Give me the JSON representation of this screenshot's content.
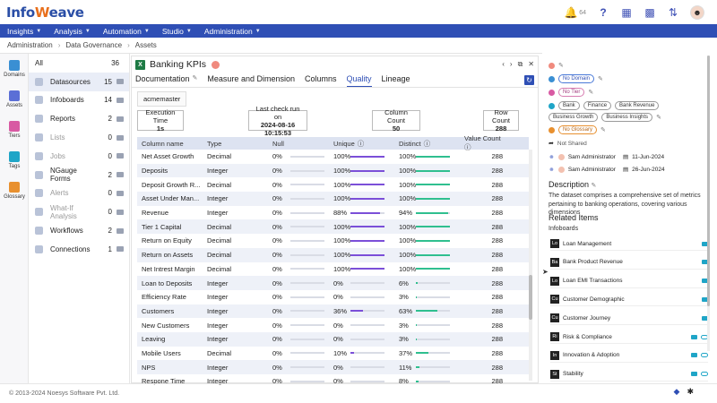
{
  "brand": {
    "prefix": "Info",
    "w": "W",
    "suffix": "eave"
  },
  "topbar": {
    "notif_count": "64"
  },
  "nav": [
    {
      "label": "Insights"
    },
    {
      "label": "Analysis"
    },
    {
      "label": "Automation"
    },
    {
      "label": "Studio"
    },
    {
      "label": "Administration"
    }
  ],
  "breadcrumb": [
    "Administration",
    "Data Governance",
    "Assets"
  ],
  "rail": [
    {
      "label": "Domains",
      "color": "#3a8fd3"
    },
    {
      "label": "Assets",
      "color": "#5b6fd6"
    },
    {
      "label": "Tiers",
      "color": "#d85aa3"
    },
    {
      "label": "Tags",
      "color": "#1fa5c7"
    },
    {
      "label": "Glossary",
      "color": "#e8902f"
    }
  ],
  "categories": [
    {
      "label": "All",
      "count": "36"
    },
    {
      "label": "Datasources",
      "count": "15"
    },
    {
      "label": "Infoboards",
      "count": "14"
    },
    {
      "label": "Reports",
      "count": "2"
    },
    {
      "label": "Lists",
      "count": "0"
    },
    {
      "label": "Jobs",
      "count": "0"
    },
    {
      "label": "NGauge Forms",
      "count": "2"
    },
    {
      "label": "Alerts",
      "count": "0"
    },
    {
      "label": "What-If Analysis",
      "count": "0"
    },
    {
      "label": "Workflows",
      "count": "2"
    },
    {
      "label": "Connections",
      "count": "1"
    }
  ],
  "asset": {
    "title": "Banking KPIs",
    "connection": "acmemaster"
  },
  "tabs": [
    "Documentation",
    "Measure and Dimension",
    "Columns",
    "Quality",
    "Lineage"
  ],
  "stats": [
    {
      "label": "Execution Time",
      "value": "1s"
    },
    {
      "label": "Last check run on",
      "value": "2024-08-16 10:15:53"
    },
    {
      "label": "Column Count",
      "value": "50"
    },
    {
      "label": "Row Count",
      "value": "288"
    }
  ],
  "table": {
    "headers": [
      "Column name",
      "Type",
      "Null",
      "Unique",
      "Distinct",
      "Value Count"
    ],
    "rows": [
      {
        "name": "Net Asset Growth",
        "type": "Decimal",
        "null": "0%",
        "unique": "100%",
        "distinct": "100%",
        "count": "288",
        "u": 1.0,
        "d": 1.0
      },
      {
        "name": "Deposits",
        "type": "Integer",
        "null": "0%",
        "unique": "100%",
        "distinct": "100%",
        "count": "288",
        "u": 1.0,
        "d": 1.0
      },
      {
        "name": "Deposit Growth R...",
        "type": "Decimal",
        "null": "0%",
        "unique": "100%",
        "distinct": "100%",
        "count": "288",
        "u": 1.0,
        "d": 1.0
      },
      {
        "name": "Asset Under Man...",
        "type": "Integer",
        "null": "0%",
        "unique": "100%",
        "distinct": "100%",
        "count": "288",
        "u": 1.0,
        "d": 1.0
      },
      {
        "name": "Revenue",
        "type": "Integer",
        "null": "0%",
        "unique": "88%",
        "distinct": "94%",
        "count": "288",
        "u": 0.88,
        "d": 0.94
      },
      {
        "name": "Tier 1 Capital",
        "type": "Decimal",
        "null": "0%",
        "unique": "100%",
        "distinct": "100%",
        "count": "288",
        "u": 1.0,
        "d": 1.0
      },
      {
        "name": "Return on Equity",
        "type": "Decimal",
        "null": "0%",
        "unique": "100%",
        "distinct": "100%",
        "count": "288",
        "u": 1.0,
        "d": 1.0
      },
      {
        "name": "Return on Assets",
        "type": "Decimal",
        "null": "0%",
        "unique": "100%",
        "distinct": "100%",
        "count": "288",
        "u": 1.0,
        "d": 1.0
      },
      {
        "name": "Net Intrest Margin",
        "type": "Decimal",
        "null": "0%",
        "unique": "100%",
        "distinct": "100%",
        "count": "288",
        "u": 1.0,
        "d": 1.0
      },
      {
        "name": "Loan to Deposits",
        "type": "Integer",
        "null": "0%",
        "unique": "0%",
        "distinct": "6%",
        "count": "288",
        "u": 0.0,
        "d": 0.06
      },
      {
        "name": "Efficiency Rate",
        "type": "Integer",
        "null": "0%",
        "unique": "0%",
        "distinct": "3%",
        "count": "288",
        "u": 0.0,
        "d": 0.03
      },
      {
        "name": "Customers",
        "type": "Integer",
        "null": "0%",
        "unique": "36%",
        "distinct": "63%",
        "count": "288",
        "u": 0.36,
        "d": 0.63
      },
      {
        "name": "New Customers",
        "type": "Integer",
        "null": "0%",
        "unique": "0%",
        "distinct": "3%",
        "count": "288",
        "u": 0.0,
        "d": 0.03
      },
      {
        "name": "Leaving",
        "type": "Integer",
        "null": "0%",
        "unique": "0%",
        "distinct": "3%",
        "count": "288",
        "u": 0.0,
        "d": 0.03
      },
      {
        "name": "Mobile Users",
        "type": "Decimal",
        "null": "0%",
        "unique": "10%",
        "distinct": "37%",
        "count": "288",
        "u": 0.1,
        "d": 0.37
      },
      {
        "name": "NPS",
        "type": "Integer",
        "null": "0%",
        "unique": "0%",
        "distinct": "11%",
        "count": "288",
        "u": 0.0,
        "d": 0.11
      },
      {
        "name": "Respone Time",
        "type": "Integer",
        "null": "0%",
        "unique": "0%",
        "distinct": "8%",
        "count": "288",
        "u": 0.0,
        "d": 0.08
      }
    ]
  },
  "right": {
    "domain_chip": "No Domain",
    "tier_chip": "No Tier",
    "tags": [
      "Bank",
      "Finance",
      "Bank Revenue",
      "Business Growth",
      "Business Insights"
    ],
    "glossary_chip": "No Glossary",
    "shared": "Not Shared",
    "created_by": "Sam Administrator",
    "created_on": "11-Jun-2024",
    "modified_by": "Sam Administrator",
    "modified_on": "26-Jun-2024",
    "description_heading": "Description",
    "description": "The dataset comprises a comprehensive set of metrics pertaining to banking operations, covering various dimensions",
    "related_heading": "Related Items",
    "infoboards_label": "Infoboards",
    "related": [
      {
        "badge": "Lo",
        "label": "Loan Management",
        "link": false
      },
      {
        "badge": "Ba",
        "label": "Bank Product Revenue",
        "link": false
      },
      {
        "badge": "Lo",
        "label": "Loan EMI Transactions",
        "link": false
      },
      {
        "badge": "Cu",
        "label": "Customer Demographic",
        "link": false
      },
      {
        "badge": "Cu",
        "label": "Customer Journey",
        "link": false
      },
      {
        "badge": "Ri",
        "label": "Risk & Compliance",
        "link": true
      },
      {
        "badge": "In",
        "label": "Innovation & Adoption",
        "link": true
      },
      {
        "badge": "St",
        "label": "Stability",
        "link": true
      }
    ]
  },
  "footer": {
    "copyright": "© 2013-2024 Noesys Software Pvt. Ltd."
  },
  "colors": {
    "primary": "#2f4fb5",
    "unique_bar": "#7b4fd8",
    "distinct_bar": "#2fbf8f"
  }
}
